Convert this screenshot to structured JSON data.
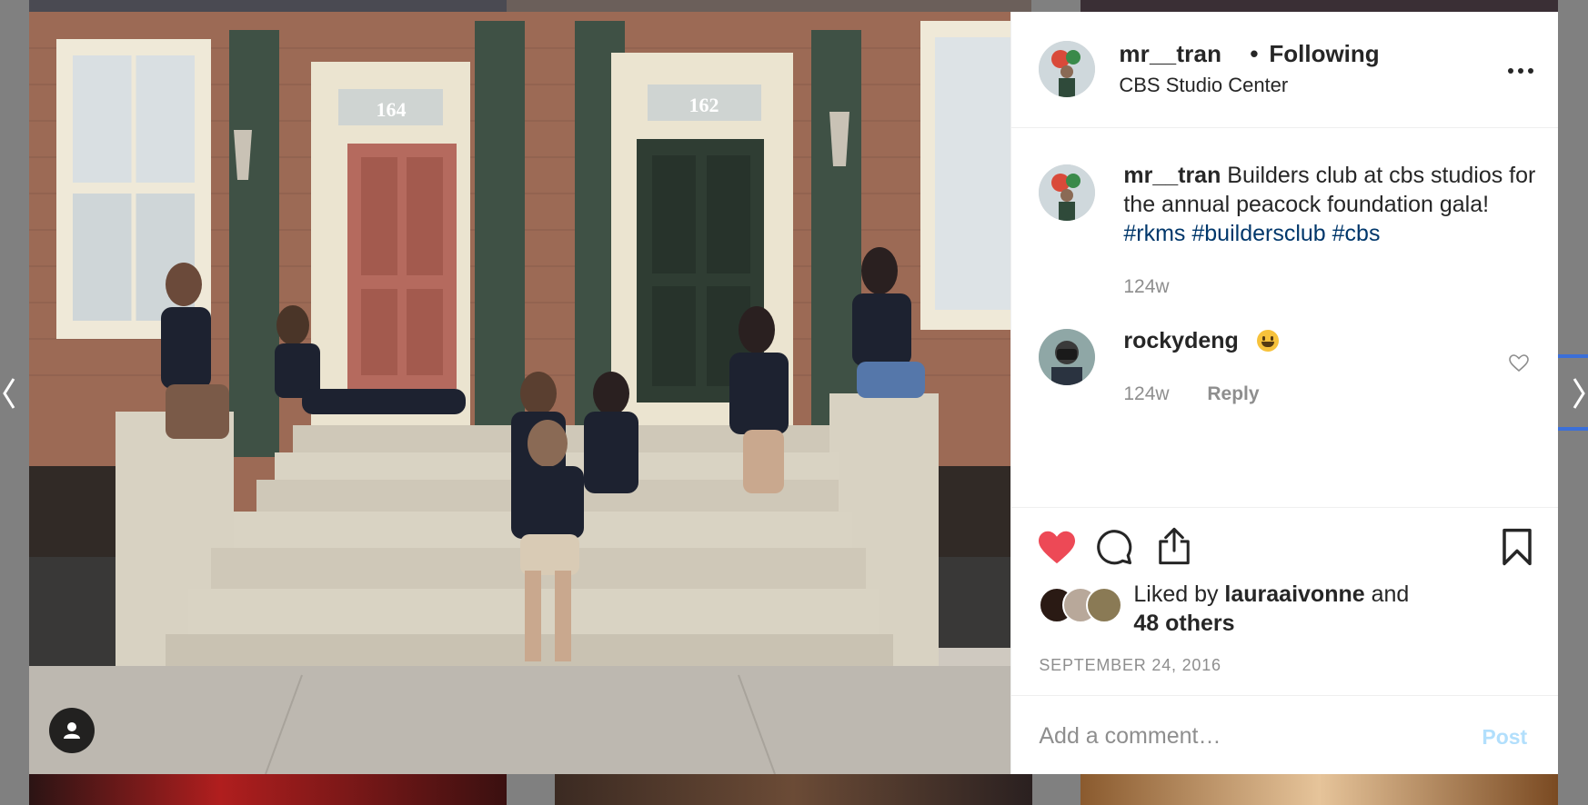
{
  "post": {
    "username": "mr__tran",
    "separator": "•",
    "follow_status": "Following",
    "location": "CBS Studio Center",
    "door_numbers": [
      "164",
      "162"
    ]
  },
  "caption": {
    "username": "mr__tran",
    "text": " Builders club at cbs studios for the annual peacock foundation gala! ",
    "hashtags": [
      "#rkms",
      "#buildersclub",
      "#cbs"
    ],
    "time": "124w"
  },
  "comments": [
    {
      "username": "rockydeng",
      "emoji": "grinning-face",
      "time": "124w",
      "reply_label": "Reply"
    }
  ],
  "likes": {
    "prefix": "Liked by ",
    "user": "lauraaivonne",
    "and": " and",
    "others": "48 others"
  },
  "date": "SEPTEMBER 24, 2016",
  "comment_box": {
    "placeholder": "Add a comment…",
    "post_label": "Post"
  },
  "icons": {
    "like": "heart-filled-icon",
    "comment": "speech-bubble-icon",
    "share": "share-icon",
    "save": "bookmark-icon",
    "more": "ellipsis-icon",
    "tag": "user-tag-icon"
  },
  "colors": {
    "liked_heart": "#ed4956",
    "hashtag": "#00376b",
    "muted": "#8e8e8e",
    "post_button_disabled": "#b2dffc"
  }
}
